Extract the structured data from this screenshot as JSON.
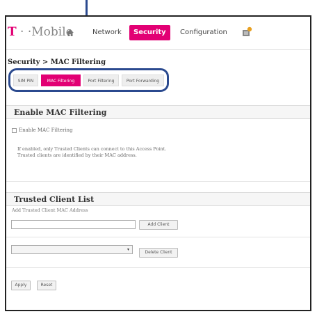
{
  "brand": {
    "logo_t": "T",
    "logo_rest": " · ·Mobile",
    "accent": "#e20074",
    "annotation_color": "#2b4a8f"
  },
  "nav": {
    "home_icon": "home-icon",
    "items": [
      {
        "label": "Network"
      },
      {
        "label": "Security"
      },
      {
        "label": "Configuration"
      }
    ],
    "notification_icon": "notification-icon"
  },
  "breadcrumb": "Security > MAC Filtering",
  "tabs": [
    {
      "label": "SIM PIN"
    },
    {
      "label": "MAC Filtering"
    },
    {
      "label": "Port Filtering"
    },
    {
      "label": "Port Forwarding"
    }
  ],
  "mac_section": {
    "title": "Enable MAC Filtering",
    "checkbox_label": "Enable MAC Filtering",
    "info_line1": "If enabled, only Trusted Clients can connect to this Access Point.",
    "info_line2": "Trusted clients are identified by their MAC address."
  },
  "trusted_section": {
    "title": "Trusted Client List",
    "field_label": "Add Trusted Client MAC Address",
    "add_button": "Add Client",
    "delete_button": "Delete Client"
  },
  "footer": {
    "apply": "Apply",
    "reset": "Reset"
  }
}
